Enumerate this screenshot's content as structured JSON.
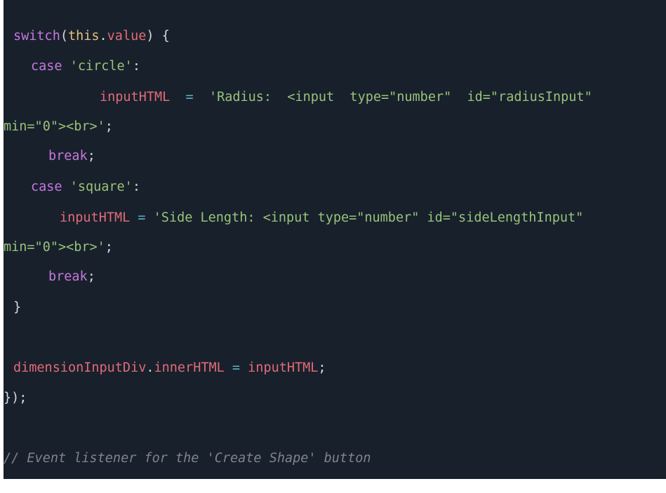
{
  "code_lines": [
    {
      "tokens": [
        {
          "text": "switch",
          "type": "keyword"
        },
        {
          "text": "(",
          "type": "punct"
        },
        {
          "text": "this",
          "type": "this"
        },
        {
          "text": ".",
          "type": "punct"
        },
        {
          "text": "value",
          "type": "var"
        },
        {
          "text": ") {",
          "type": "punct"
        }
      ]
    },
    {
      "tokens": [
        {
          "text": "case",
          "type": "keyword"
        },
        {
          "text": " ",
          "type": "punct"
        },
        {
          "text": "'circle'",
          "type": "string"
        },
        {
          "text": ":",
          "type": "punct"
        }
      ]
    },
    {
      "tokens": [
        {
          "text": "inputHTML",
          "type": "var"
        },
        {
          "text": "  ",
          "type": "punct"
        },
        {
          "text": "=",
          "type": "op"
        },
        {
          "text": "  ",
          "type": "punct"
        },
        {
          "text": "'Radius:  <input  type=\"number\"  id=\"radiusInput\"",
          "type": "string"
        }
      ]
    },
    {
      "tokens": [
        {
          "text": "min=\"0\"><br>'",
          "type": "string"
        },
        {
          "text": ";",
          "type": "punct"
        }
      ]
    },
    {
      "tokens": [
        {
          "text": "break",
          "type": "keyword"
        },
        {
          "text": ";",
          "type": "punct"
        }
      ]
    },
    {
      "tokens": [
        {
          "text": "case",
          "type": "keyword"
        },
        {
          "text": " ",
          "type": "punct"
        },
        {
          "text": "'square'",
          "type": "string"
        },
        {
          "text": ":",
          "type": "punct"
        }
      ]
    },
    {
      "tokens": [
        {
          "text": "inputHTML",
          "type": "var"
        },
        {
          "text": " ",
          "type": "punct"
        },
        {
          "text": "=",
          "type": "op"
        },
        {
          "text": " ",
          "type": "punct"
        },
        {
          "text": "'Side Length: <input type=\"number\" id=\"sideLengthInput\"",
          "type": "string"
        }
      ]
    },
    {
      "tokens": [
        {
          "text": "min=\"0\"><br>'",
          "type": "string"
        },
        {
          "text": ";",
          "type": "punct"
        }
      ]
    },
    {
      "tokens": [
        {
          "text": "break",
          "type": "keyword"
        },
        {
          "text": ";",
          "type": "punct"
        }
      ]
    },
    {
      "tokens": [
        {
          "text": "}",
          "type": "punct"
        }
      ]
    },
    {
      "tokens": [
        {
          "text": "dimensionInputDiv",
          "type": "var"
        },
        {
          "text": ".",
          "type": "punct"
        },
        {
          "text": "innerHTML",
          "type": "var"
        },
        {
          "text": " ",
          "type": "punct"
        },
        {
          "text": "=",
          "type": "op"
        },
        {
          "text": " ",
          "type": "punct"
        },
        {
          "text": "inputHTML",
          "type": "var"
        },
        {
          "text": ";",
          "type": "punct"
        }
      ]
    },
    {
      "tokens": [
        {
          "text": "});",
          "type": "punct"
        }
      ]
    },
    {
      "tokens": [
        {
          "text": "// Event listener for the 'Create Shape' button",
          "type": "comment"
        }
      ]
    }
  ]
}
